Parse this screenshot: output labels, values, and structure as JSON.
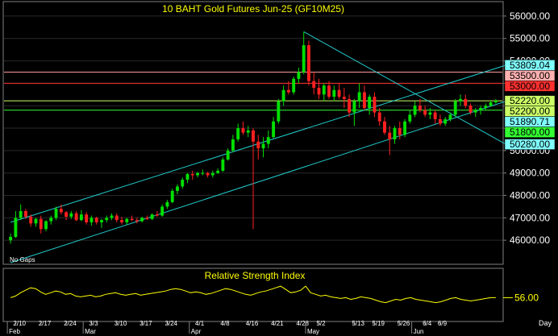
{
  "chart_data": [
    {
      "type": "candlestick",
      "title": "10 BAHT  Gold Futures Jun-25  (GF10M25)",
      "ylim": [
        45000,
        56500
      ],
      "y_ticks": [
        "46000.00",
        "47000.00",
        "48000.00",
        "49000.00",
        "50000.00",
        "51000.00",
        "52000.00",
        "53000.00",
        "54000.00",
        "55000.00",
        "56000.00"
      ],
      "annotation": "No Gaps",
      "price_levels": [
        {
          "label": "53809.04",
          "value": 53809.04,
          "color": "#7fffff"
        },
        {
          "label": "53500.00",
          "value": 53500,
          "color": "#ffb0b0"
        },
        {
          "label": "53000.00",
          "value": 53000,
          "color": "#ff3030"
        },
        {
          "label": "52220.00",
          "value": 52220,
          "color": "#ccff66"
        },
        {
          "label": "52200.00",
          "value": 52200,
          "color": "#ccff66"
        },
        {
          "label": "51890.71",
          "value": 51890.71,
          "color": "#7fffff"
        },
        {
          "label": "51800.00",
          "value": 51800,
          "color": "#33ff33"
        },
        {
          "label": "50280.00",
          "value": 50280,
          "color": "#7fffff"
        }
      ],
      "horizontal_lines": [
        {
          "value": 53500,
          "color": "#ff9a9a"
        },
        {
          "value": 53000,
          "color": "#ff3030"
        },
        {
          "value": 52220,
          "color": "#ccff66"
        },
        {
          "value": 51800,
          "color": "#33ff33"
        }
      ],
      "trendlines": [
        {
          "from": [
            0,
            46800
          ],
          "to": [
            98,
            53809
          ],
          "color": "#22cccc"
        },
        {
          "from": [
            0,
            45000
          ],
          "to": [
            98,
            52200
          ],
          "color": "#22cccc"
        },
        {
          "from": [
            58,
            55300
          ],
          "to": [
            98,
            50280
          ],
          "color": "#22cccc"
        }
      ],
      "candles": [
        {
          "o": 46000,
          "h": 46300,
          "l": 45850,
          "c": 46150
        },
        {
          "o": 46150,
          "h": 47300,
          "l": 46100,
          "c": 47000
        },
        {
          "o": 47000,
          "h": 47600,
          "l": 46900,
          "c": 47300
        },
        {
          "o": 47300,
          "h": 47400,
          "l": 46950,
          "c": 47050
        },
        {
          "o": 47050,
          "h": 47150,
          "l": 46600,
          "c": 46750
        },
        {
          "o": 46750,
          "h": 47000,
          "l": 46600,
          "c": 46950
        },
        {
          "o": 46950,
          "h": 47100,
          "l": 46300,
          "c": 46500
        },
        {
          "o": 46500,
          "h": 46900,
          "l": 46400,
          "c": 46850
        },
        {
          "o": 46850,
          "h": 47100,
          "l": 46700,
          "c": 47000
        },
        {
          "o": 47000,
          "h": 47500,
          "l": 46900,
          "c": 47400
        },
        {
          "o": 47400,
          "h": 47600,
          "l": 47150,
          "c": 47250
        },
        {
          "o": 47250,
          "h": 47300,
          "l": 46900,
          "c": 47050
        },
        {
          "o": 47050,
          "h": 47300,
          "l": 46950,
          "c": 47200
        },
        {
          "o": 47200,
          "h": 47300,
          "l": 46850,
          "c": 46900
        },
        {
          "o": 46900,
          "h": 47350,
          "l": 46850,
          "c": 47150
        },
        {
          "o": 47150,
          "h": 47250,
          "l": 46700,
          "c": 46800
        },
        {
          "o": 46800,
          "h": 47100,
          "l": 46650,
          "c": 47000
        },
        {
          "o": 47000,
          "h": 47050,
          "l": 46700,
          "c": 46800
        },
        {
          "o": 46800,
          "h": 46950,
          "l": 46550,
          "c": 46900
        },
        {
          "o": 46900,
          "h": 47100,
          "l": 46800,
          "c": 47000
        },
        {
          "o": 47000,
          "h": 47200,
          "l": 46900,
          "c": 47100
        },
        {
          "o": 47100,
          "h": 47200,
          "l": 46800,
          "c": 46900
        },
        {
          "o": 46900,
          "h": 47050,
          "l": 46700,
          "c": 46800
        },
        {
          "o": 46800,
          "h": 47000,
          "l": 46700,
          "c": 46950
        },
        {
          "o": 46950,
          "h": 47100,
          "l": 46850,
          "c": 46900
        },
        {
          "o": 46900,
          "h": 47000,
          "l": 46750,
          "c": 46850
        },
        {
          "o": 46850,
          "h": 47050,
          "l": 46800,
          "c": 47000
        },
        {
          "o": 47000,
          "h": 47100,
          "l": 46900,
          "c": 46950
        },
        {
          "o": 46950,
          "h": 47200,
          "l": 46900,
          "c": 47150
        },
        {
          "o": 47150,
          "h": 47300,
          "l": 47050,
          "c": 47100
        },
        {
          "o": 47100,
          "h": 47600,
          "l": 47050,
          "c": 47500
        },
        {
          "o": 47500,
          "h": 47800,
          "l": 47400,
          "c": 47700
        },
        {
          "o": 47700,
          "h": 48300,
          "l": 47650,
          "c": 48200
        },
        {
          "o": 48200,
          "h": 48500,
          "l": 48050,
          "c": 48400
        },
        {
          "o": 48400,
          "h": 48800,
          "l": 48300,
          "c": 48700
        },
        {
          "o": 48700,
          "h": 49000,
          "l": 48550,
          "c": 48950
        },
        {
          "o": 48950,
          "h": 49100,
          "l": 48700,
          "c": 48900
        },
        {
          "o": 48900,
          "h": 49050,
          "l": 48800,
          "c": 49000
        },
        {
          "o": 49000,
          "h": 49150,
          "l": 48900,
          "c": 49000
        },
        {
          "o": 49000,
          "h": 49050,
          "l": 48800,
          "c": 48900
        },
        {
          "o": 48900,
          "h": 49100,
          "l": 48800,
          "c": 49000
        },
        {
          "o": 49000,
          "h": 49200,
          "l": 48950,
          "c": 49100
        },
        {
          "o": 49100,
          "h": 49700,
          "l": 49050,
          "c": 49600
        },
        {
          "o": 49600,
          "h": 50100,
          "l": 49550,
          "c": 50000
        },
        {
          "o": 50000,
          "h": 50700,
          "l": 49950,
          "c": 50500
        },
        {
          "o": 50500,
          "h": 51200,
          "l": 50400,
          "c": 51000
        },
        {
          "o": 51000,
          "h": 51300,
          "l": 50700,
          "c": 50800
        },
        {
          "o": 50800,
          "h": 51100,
          "l": 50600,
          "c": 50900
        },
        {
          "o": 50900,
          "h": 51000,
          "l": 46500,
          "c": 50400
        },
        {
          "o": 50400,
          "h": 50700,
          "l": 49600,
          "c": 50100
        },
        {
          "o": 50100,
          "h": 50600,
          "l": 49700,
          "c": 50300
        },
        {
          "o": 50300,
          "h": 50900,
          "l": 50100,
          "c": 50600
        },
        {
          "o": 50600,
          "h": 51500,
          "l": 50550,
          "c": 51300
        },
        {
          "o": 51300,
          "h": 52300,
          "l": 51200,
          "c": 52200
        },
        {
          "o": 52200,
          "h": 52900,
          "l": 52000,
          "c": 52700
        },
        {
          "o": 52700,
          "h": 53100,
          "l": 52500,
          "c": 52600
        },
        {
          "o": 52600,
          "h": 53300,
          "l": 52500,
          "c": 53200
        },
        {
          "o": 53200,
          "h": 53700,
          "l": 53000,
          "c": 53500
        },
        {
          "o": 53500,
          "h": 55300,
          "l": 53400,
          "c": 54700
        },
        {
          "o": 54700,
          "h": 54900,
          "l": 52900,
          "c": 53100
        },
        {
          "o": 53100,
          "h": 53500,
          "l": 52500,
          "c": 52800
        },
        {
          "o": 52800,
          "h": 53200,
          "l": 52300,
          "c": 52500
        },
        {
          "o": 52500,
          "h": 53000,
          "l": 52200,
          "c": 52900
        },
        {
          "o": 52900,
          "h": 53100,
          "l": 52300,
          "c": 52400
        },
        {
          "o": 52400,
          "h": 52900,
          "l": 52200,
          "c": 52700
        },
        {
          "o": 52700,
          "h": 53000,
          "l": 52300,
          "c": 52400
        },
        {
          "o": 52400,
          "h": 52800,
          "l": 51900,
          "c": 52300
        },
        {
          "o": 52300,
          "h": 52500,
          "l": 51500,
          "c": 51700
        },
        {
          "o": 51700,
          "h": 52300,
          "l": 51100,
          "c": 52200
        },
        {
          "o": 52200,
          "h": 53000,
          "l": 51900,
          "c": 52600
        },
        {
          "o": 52600,
          "h": 52900,
          "l": 51800,
          "c": 51900
        },
        {
          "o": 51900,
          "h": 52500,
          "l": 51600,
          "c": 52400
        },
        {
          "o": 52400,
          "h": 52600,
          "l": 51500,
          "c": 51700
        },
        {
          "o": 51700,
          "h": 51900,
          "l": 51100,
          "c": 51300
        },
        {
          "o": 51300,
          "h": 51500,
          "l": 50700,
          "c": 50800
        },
        {
          "o": 50800,
          "h": 51100,
          "l": 49800,
          "c": 50500
        },
        {
          "o": 50500,
          "h": 51100,
          "l": 50300,
          "c": 51000
        },
        {
          "o": 51000,
          "h": 51300,
          "l": 50500,
          "c": 50700
        },
        {
          "o": 50700,
          "h": 51400,
          "l": 50600,
          "c": 51300
        },
        {
          "o": 51300,
          "h": 51800,
          "l": 51200,
          "c": 51600
        },
        {
          "o": 51600,
          "h": 52200,
          "l": 51500,
          "c": 52000
        },
        {
          "o": 52000,
          "h": 52300,
          "l": 51700,
          "c": 51800
        },
        {
          "o": 51800,
          "h": 52000,
          "l": 51500,
          "c": 51600
        },
        {
          "o": 51600,
          "h": 51900,
          "l": 51400,
          "c": 51700
        },
        {
          "o": 51700,
          "h": 51800,
          "l": 51200,
          "c": 51400
        },
        {
          "o": 51400,
          "h": 51600,
          "l": 51100,
          "c": 51200
        },
        {
          "o": 51200,
          "h": 51500,
          "l": 51100,
          "c": 51400
        },
        {
          "o": 51400,
          "h": 51700,
          "l": 51300,
          "c": 51600
        },
        {
          "o": 51600,
          "h": 52300,
          "l": 51500,
          "c": 52200
        },
        {
          "o": 52200,
          "h": 52500,
          "l": 52000,
          "c": 52300
        },
        {
          "o": 52300,
          "h": 52500,
          "l": 51900,
          "c": 52000
        },
        {
          "o": 52000,
          "h": 52100,
          "l": 51600,
          "c": 51700
        },
        {
          "o": 51700,
          "h": 51900,
          "l": 51500,
          "c": 51800
        },
        {
          "o": 51800,
          "h": 52000,
          "l": 51600,
          "c": 51900
        },
        {
          "o": 51900,
          "h": 52100,
          "l": 51800,
          "c": 52000
        },
        {
          "o": 52000,
          "h": 52250,
          "l": 51950,
          "c": 52150
        },
        {
          "o": 52150,
          "h": 52300,
          "l": 52100,
          "c": 52220
        }
      ],
      "x_tick_labels": [
        {
          "label": "2/10",
          "index": 1
        },
        {
          "label": "2/17",
          "index": 6
        },
        {
          "label": "2/24",
          "index": 11
        },
        {
          "label": "3/3",
          "index": 16
        },
        {
          "label": "3/10",
          "index": 21
        },
        {
          "label": "3/17",
          "index": 26
        },
        {
          "label": "3/24",
          "index": 31
        },
        {
          "label": "4/1",
          "index": 37
        },
        {
          "label": "4/8",
          "index": 42
        },
        {
          "label": "4/16",
          "index": 47
        },
        {
          "label": "4/21",
          "index": 52
        },
        {
          "label": "4/28",
          "index": 57
        },
        {
          "label": "5/2",
          "index": 61
        },
        {
          "label": "5/13",
          "index": 68
        },
        {
          "label": "5/19",
          "index": 72
        },
        {
          "label": "5/26",
          "index": 77
        },
        {
          "label": "6/4",
          "index": 82
        },
        {
          "label": "6/9",
          "index": 85
        }
      ],
      "month_labels": [
        {
          "label": "Feb",
          "index": 0
        },
        {
          "label": "Mar",
          "index": 15
        },
        {
          "label": "Apr",
          "index": 36
        },
        {
          "label": "May",
          "index": 59
        },
        {
          "label": "Jun",
          "index": 80
        }
      ],
      "right_axis_label": "Day"
    },
    {
      "type": "line",
      "title": "Relative Strength Index",
      "ylim": [
        30,
        75
      ],
      "current_value_label": "56.00",
      "values": [
        56,
        58,
        62,
        65,
        68,
        67,
        63,
        60,
        62,
        64,
        63,
        60,
        61,
        58,
        57,
        58,
        59,
        57,
        58,
        60,
        61,
        62,
        60,
        59,
        60,
        61,
        59,
        60,
        61,
        62,
        63,
        64,
        66,
        67,
        66,
        64,
        62,
        63,
        62,
        60,
        61,
        63,
        65,
        67,
        66,
        64,
        62,
        60,
        59,
        61,
        63,
        64,
        66,
        68,
        70,
        66,
        62,
        63,
        65,
        70,
        62,
        60,
        58,
        59,
        57,
        56,
        55,
        56,
        54,
        55,
        57,
        56,
        55,
        53,
        51,
        50,
        52,
        54,
        53,
        55,
        56,
        54,
        53,
        52,
        51,
        50,
        51,
        53,
        55,
        56,
        54,
        53,
        52,
        53,
        54,
        55,
        56,
        56
      ]
    }
  ]
}
